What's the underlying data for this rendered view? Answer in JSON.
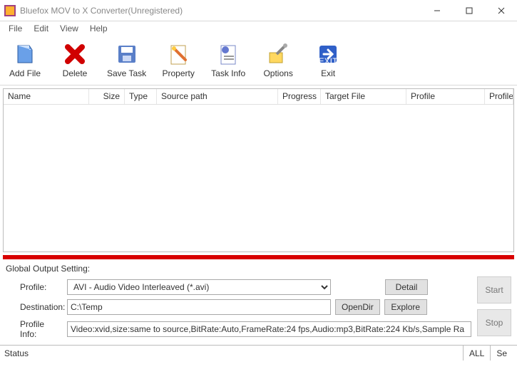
{
  "window": {
    "title": "Bluefox MOV to X Converter(Unregistered)"
  },
  "menu": {
    "file": "File",
    "edit": "Edit",
    "view": "View",
    "help": "Help"
  },
  "toolbar": {
    "add_file": "Add File",
    "delete": "Delete",
    "save_task": "Save Task",
    "property": "Property",
    "task_info": "Task Info",
    "options": "Options",
    "exit": "Exit"
  },
  "columns": {
    "name": "Name",
    "size": "Size",
    "type": "Type",
    "source_path": "Source path",
    "progress": "Progress",
    "target_file": "Target File",
    "profile": "Profile",
    "profile_i": "Profile I"
  },
  "settings": {
    "section_title": "Global Output Setting:",
    "profile_label": "Profile:",
    "profile_value": "AVI - Audio Video Interleaved (*.avi)",
    "destination_label": "Destination:",
    "destination_value": "C:\\Temp",
    "profile_info_label": "Profile Info:",
    "profile_info_value": "Video:xvid,size:same to source,BitRate:Auto,FrameRate:24 fps,Audio:mp3,BitRate:224 Kb/s,Sample Ra",
    "detail_btn": "Detail",
    "opendir_btn": "OpenDir",
    "explore_btn": "Explore",
    "start_btn": "Start",
    "stop_btn": "Stop"
  },
  "status": {
    "label": "Status",
    "all": "ALL",
    "se": "Se"
  }
}
